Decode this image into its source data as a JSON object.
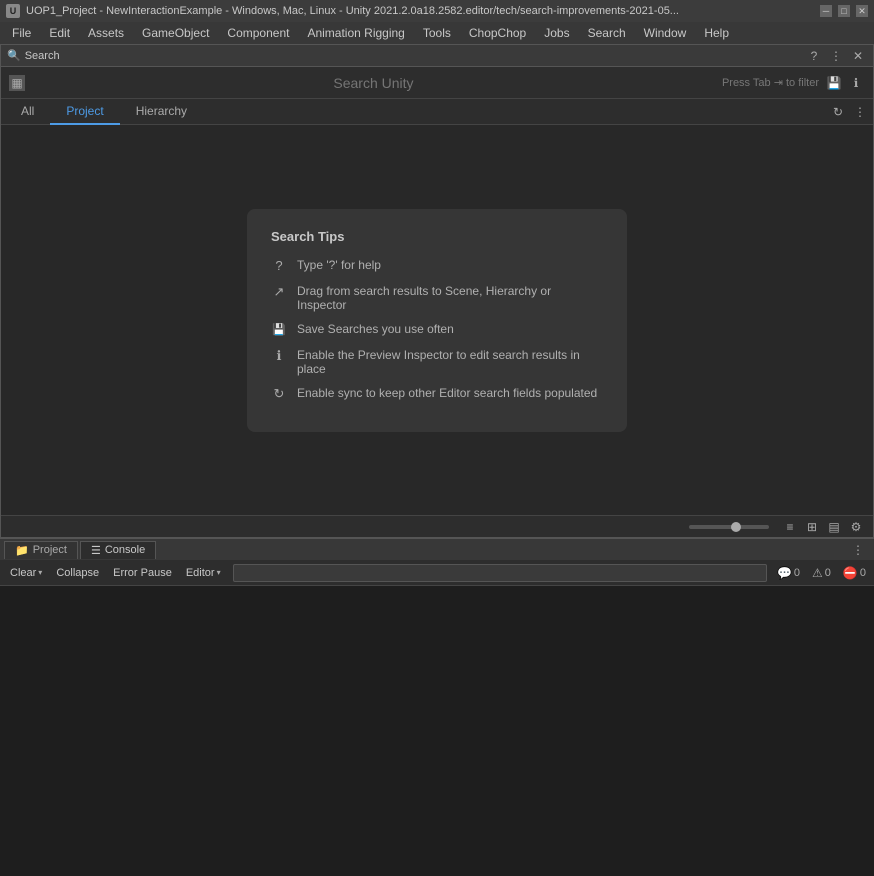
{
  "titlebar": {
    "icon": "U",
    "text": "UOP1_Project - NewInteractionExample - Windows, Mac, Linux - Unity 2021.2.0a18.2582.editor/tech/search-improvements-2021-05...",
    "minimize": "─",
    "maximize": "□",
    "close": "✕"
  },
  "menubar": {
    "items": [
      "File",
      "Edit",
      "Assets",
      "GameObject",
      "Component",
      "Animation Rigging",
      "Tools",
      "ChopChop",
      "Jobs",
      "Search",
      "Window",
      "Help"
    ]
  },
  "search_window": {
    "title": "Search",
    "titlebar_icons": {
      "help": "?",
      "more": "⋮",
      "close": "✕"
    },
    "input_placeholder": "Search Unity",
    "filter_hint": "Press Tab ⇥ to filter",
    "sidebar_toggle": "▦"
  },
  "tabs": {
    "items": [
      "All",
      "Project",
      "Hierarchy"
    ],
    "active": "Project",
    "refresh_icon": "↻",
    "more_icon": "⋮"
  },
  "search_tips": {
    "title": "Search Tips",
    "tips": [
      {
        "icon": "?",
        "text": "Type '?' for help"
      },
      {
        "icon": "↗",
        "text": "Drag from search results to Scene, Hierarchy or Inspector"
      },
      {
        "icon": "🖫",
        "text": "Save Searches you use often"
      },
      {
        "icon": "ℹ",
        "text": "Enable the Preview Inspector to edit search results in place"
      },
      {
        "icon": "↻",
        "text": "Enable sync to keep other Editor search fields populated"
      }
    ]
  },
  "bottom_toolbar": {
    "list_icon": "≡",
    "grid_icon": "⊞",
    "table_icon": "▤",
    "settings_icon": "⚙",
    "slider_value": 60
  },
  "panel_tabs": {
    "items": [
      {
        "label": "Project",
        "icon": "📁",
        "active": false
      },
      {
        "label": "Console",
        "icon": "☰",
        "active": true
      }
    ],
    "more_icon": "⋮"
  },
  "console_toolbar": {
    "clear_label": "Clear",
    "collapse_label": "Collapse",
    "error_pause_label": "Error Pause",
    "editor_label": "Editor",
    "search_placeholder": "",
    "badges": [
      {
        "icon": "💬",
        "count": "0",
        "type": "message"
      },
      {
        "icon": "⚠",
        "count": "0",
        "type": "warning"
      },
      {
        "icon": "⛔",
        "count": "0",
        "type": "error"
      }
    ]
  }
}
